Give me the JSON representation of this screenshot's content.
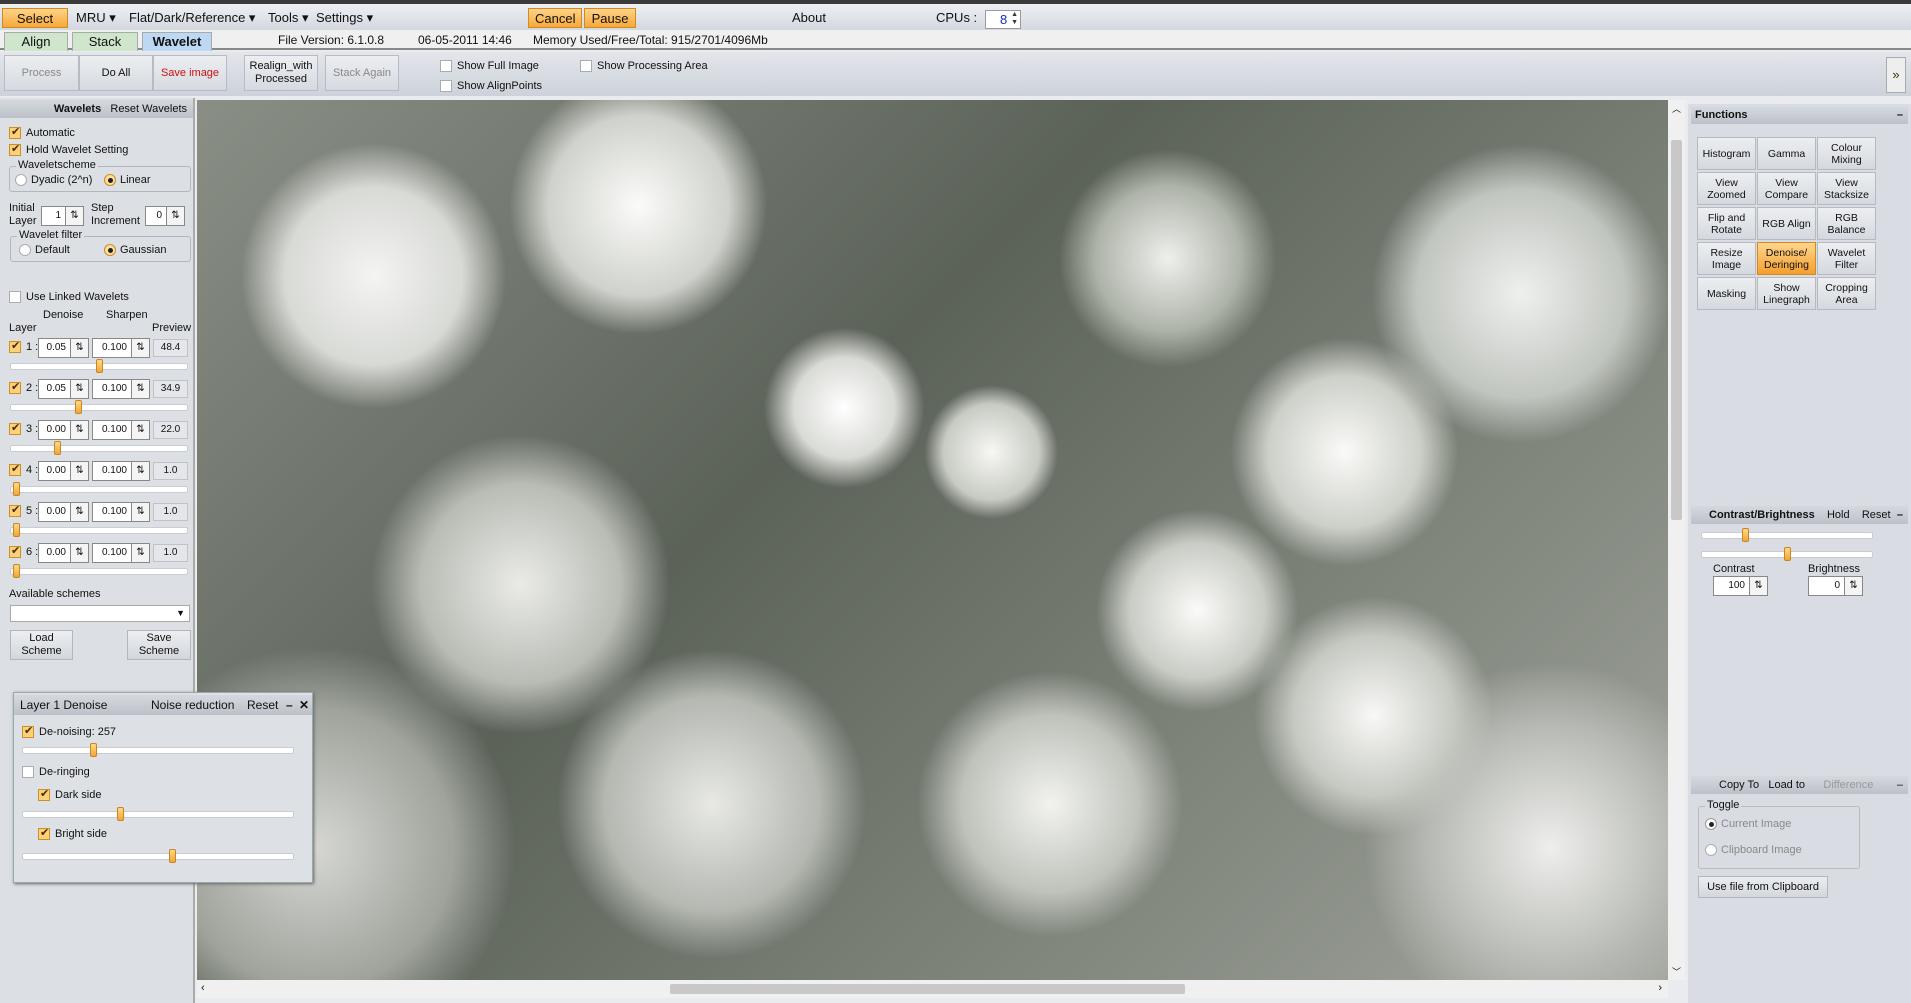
{
  "menu": {
    "select": "Select",
    "mru": "MRU ▾",
    "flat": "Flat/Dark/Reference ▾",
    "tools": "Tools ▾",
    "settings": "Settings ▾",
    "cancel": "Cancel",
    "pause": "Pause",
    "about": "About",
    "cpus_label": "CPUs :",
    "cpus_value": "8"
  },
  "tabs": {
    "align": "Align",
    "stack": "Stack",
    "wavelet": "Wavelet"
  },
  "info": {
    "version": "File Version: 6.1.0.8",
    "date": "06-05-2011 14:46",
    "memory": "Memory Used/Free/Total: 915/2701/4096Mb"
  },
  "toolbar": {
    "process": "Process",
    "do_all": "Do All",
    "save": "Save image",
    "realign": "Realign_with Processed",
    "stack_again": "Stack Again",
    "show_full": "Show Full Image",
    "show_align": "Show AlignPoints",
    "show_proc": "Show Processing Area",
    "expand": "»"
  },
  "wavelets": {
    "title": "Wavelets",
    "reset": "Reset Wavelets",
    "automatic": "Automatic",
    "hold": "Hold Wavelet Setting",
    "scheme_label": "Waveletscheme",
    "dyadic": "Dyadic (2^n)",
    "linear": "Linear",
    "initial_layer": "Initial Layer",
    "initial_value": "1",
    "step": "Step Increment",
    "step_value": "0",
    "filter_label": "Wavelet filter",
    "default": "Default",
    "gaussian": "Gaussian",
    "linked": "Use Linked Wavelets",
    "col_layer": "Layer",
    "col_denoise": "Denoise",
    "col_sharpen": "Sharpen",
    "col_preview": "Preview",
    "layers": [
      {
        "n": "1 :",
        "denoise": "0.05",
        "sharpen": "0.100",
        "preview": "48.4",
        "level": 0.5
      },
      {
        "n": "2 :",
        "denoise": "0.05",
        "sharpen": "0.100",
        "preview": "34.9",
        "level": 0.38
      },
      {
        "n": "3 :",
        "denoise": "0.00",
        "sharpen": "0.100",
        "preview": "22.0",
        "level": 0.26
      },
      {
        "n": "4 :",
        "denoise": "0.00",
        "sharpen": "0.100",
        "preview": "1.0",
        "level": 0.03
      },
      {
        "n": "5 :",
        "denoise": "0.00",
        "sharpen": "0.100",
        "preview": "1.0",
        "level": 0.03
      },
      {
        "n": "6 :",
        "denoise": "0.00",
        "sharpen": "0.100",
        "preview": "1.0",
        "level": 0.03
      }
    ],
    "available": "Available schemes",
    "load": "Load Scheme",
    "save": "Save Scheme"
  },
  "denoise": {
    "title": "Layer 1 Denoise",
    "noise": "Noise reduction",
    "reset": "Reset",
    "denoising": "De-noising: 257",
    "deringing": "De-ringing",
    "dark": "Dark side",
    "bright": "Bright side",
    "denoise_level": 0.26,
    "dark_level": 0.36,
    "bright_level": 0.55
  },
  "functions": {
    "title": "Functions",
    "buttons": [
      "Histogram",
      "Gamma",
      "Colour Mixing",
      "View Zoomed",
      "View Compare",
      "View Stacksize",
      "Flip and Rotate",
      "RGB Align",
      "RGB Balance",
      "Resize Image",
      "Denoise/ Deringing",
      "Wavelet Filter",
      "Masking",
      "Show Linegraph",
      "Cropping Area"
    ],
    "active": "Denoise/ Deringing"
  },
  "contrast": {
    "title": "Contrast/Brightness",
    "hold": "Hold",
    "reset": "Reset",
    "contrast_label": "Contrast",
    "contrast_value": "100",
    "brightness_label": "Brightness",
    "brightness_value": "0",
    "contrast_level": 0.25,
    "brightness_level": 0.5
  },
  "copy": {
    "copy_to": "Copy To",
    "load_to": "Load to",
    "difference": "Difference",
    "toggle": "Toggle",
    "current": "Current Image",
    "clipboard": "Clipboard Image",
    "use_file": "Use file from Clipboard"
  },
  "colors": {
    "accent": "#f7a83a",
    "save_text": "#d01010",
    "active_tab": "#bcd8f2",
    "tab_green": "#cfe6cc"
  }
}
